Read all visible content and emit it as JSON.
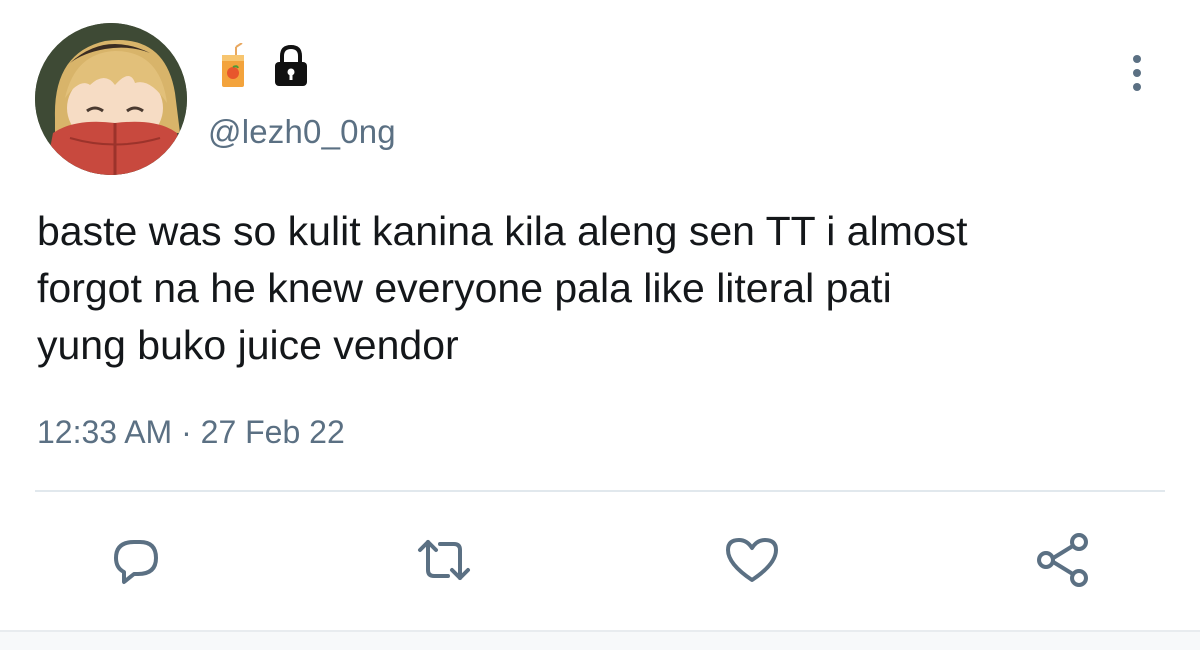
{
  "user": {
    "handle": "@lezh0_0ng",
    "name_icons": [
      "juice-box-icon",
      "lock-icon"
    ],
    "avatar": "anime-character-avatar"
  },
  "tweet": {
    "text": "baste was so kulit kanina kila aleng sen TT i almost\nforgot na he knew everyone pala like literal pati\nyung buko juice vendor",
    "timestamp": "12:33 AM · 27 Feb 22"
  },
  "actions": [
    "reply-icon",
    "retweet-icon",
    "like-icon",
    "share-icon"
  ],
  "colors": {
    "text": "#14171a",
    "secondary": "#5b7083",
    "divider": "#e1e8ed"
  }
}
